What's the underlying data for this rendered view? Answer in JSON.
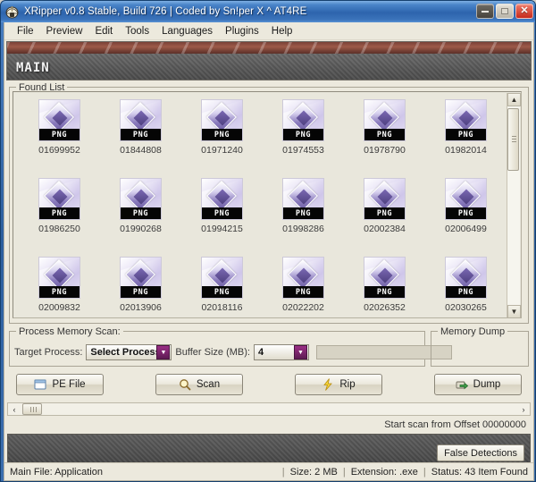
{
  "window": {
    "title": "XRipper v0.8 Stable, Build 726 | Coded by Sn!per X ^ AT4RE",
    "app_icon": "helmet-icon",
    "controls": {
      "minimize": "minimize-icon",
      "maximize": "maximize-icon",
      "close": "close-icon"
    }
  },
  "menubar": {
    "items": [
      {
        "label": "File"
      },
      {
        "label": "Preview"
      },
      {
        "label": "Edit"
      },
      {
        "label": "Tools"
      },
      {
        "label": "Languages"
      },
      {
        "label": "Plugins"
      },
      {
        "label": "Help"
      }
    ]
  },
  "banner": {
    "label": "MAIN"
  },
  "found_list": {
    "title": "Found List",
    "items": [
      {
        "name": "01699952",
        "format": "PNG"
      },
      {
        "name": "01844808",
        "format": "PNG"
      },
      {
        "name": "01971240",
        "format": "PNG"
      },
      {
        "name": "01974553",
        "format": "PNG"
      },
      {
        "name": "01978790",
        "format": "PNG"
      },
      {
        "name": "01982014",
        "format": "PNG"
      },
      {
        "name": "01986250",
        "format": "PNG"
      },
      {
        "name": "01990268",
        "format": "PNG"
      },
      {
        "name": "01994215",
        "format": "PNG"
      },
      {
        "name": "01998286",
        "format": "PNG"
      },
      {
        "name": "02002384",
        "format": "PNG"
      },
      {
        "name": "02006499",
        "format": "PNG"
      },
      {
        "name": "02009832",
        "format": "PNG"
      },
      {
        "name": "02013906",
        "format": "PNG"
      },
      {
        "name": "02018116",
        "format": "PNG"
      },
      {
        "name": "02022202",
        "format": "PNG"
      },
      {
        "name": "02026352",
        "format": "PNG"
      },
      {
        "name": "02030265",
        "format": "PNG"
      }
    ],
    "scrollbar": {
      "up_arrow": "▲",
      "down_arrow": "▼"
    }
  },
  "process_memory_scan": {
    "title": "Process Memory Scan:",
    "target_process_label": "Target Process:",
    "target_process_value": "Select Process..",
    "buffer_size_label": "Buffer Size (MB):",
    "buffer_size_value": "4",
    "dropdown_arrow": "▼"
  },
  "memory_dump": {
    "title": "Memory Dump"
  },
  "actions": [
    {
      "label": "PE File",
      "icon": "window-icon"
    },
    {
      "label": "Scan",
      "icon": "magnifier-icon"
    },
    {
      "label": "Rip",
      "icon": "lightning-icon"
    },
    {
      "label": "Dump",
      "icon": "disk-arrow-icon"
    }
  ],
  "hscroll": {
    "left_arrow": "‹",
    "right_arrow": "›"
  },
  "offset_info": {
    "text": "Start scan from Offset 00000000"
  },
  "false_detections": {
    "label": "False Detections"
  },
  "statusbar": {
    "main_file": "Main File: Application",
    "size": "Size: 2 MB",
    "extension": "Extension: .exe",
    "status": "Status: 43 Item Found",
    "separator": "|"
  },
  "colors": {
    "title_bar": "#2d64ad",
    "window_bg": "#ece9dd",
    "banner_strip": "#8a4a3c",
    "banner_body": "#5a5a5a",
    "accent_purple": "#7b2a6b",
    "close_red": "#c62a1c"
  }
}
